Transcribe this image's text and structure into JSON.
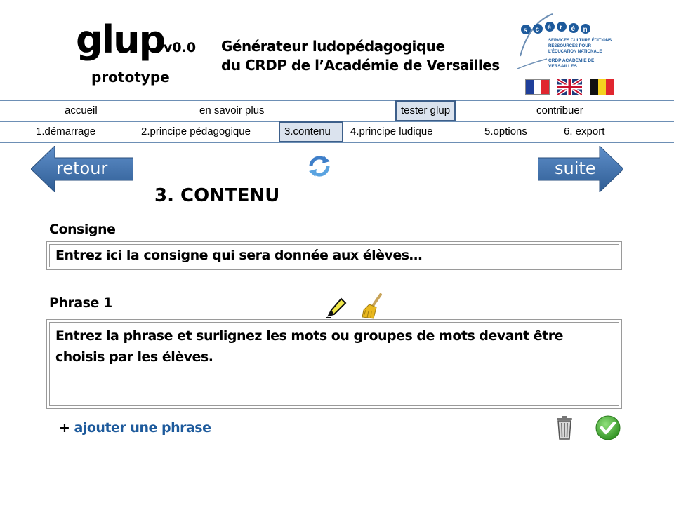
{
  "header": {
    "logo": "glup",
    "version": "v0.0",
    "subtitle": "prototype",
    "tagline_line1": "Générateur ludopédagogique",
    "tagline_line2": "du CRDP de l’Académie de Versailles",
    "partner_logo": {
      "name": "scérén",
      "subtext": "SERVICES CULTURE ÉDITIONS RESSOURCES POUR L’ÉDUCATION NATIONALE",
      "crdp": "CRDP ACADÉMIE DE VERSAILLES"
    },
    "languages": [
      "fr-flag-icon",
      "uk-flag-icon",
      "be-flag-icon"
    ]
  },
  "main_nav": {
    "items": [
      "accueil",
      "en savoir plus",
      "tester glup",
      "contribuer"
    ],
    "active": "tester glup"
  },
  "step_nav": {
    "items": [
      "1.démarrage",
      "2.principe pédagogique",
      "3.contenu",
      "4.principe ludique",
      "5.options",
      "6. export"
    ],
    "active": "3.contenu"
  },
  "controls": {
    "back_label": "retour",
    "next_label": "suite",
    "refresh_icon": "refresh-icon"
  },
  "content": {
    "section_title": "3. CONTENU",
    "instruction_label": "Consigne",
    "instruction_placeholder": "Entrez ici la consigne qui sera donnée aux élèves…",
    "phrase_label": "Phrase 1",
    "phrase_placeholder": "Entrez la phrase et surlignez les mots ou groupes de mots devant être choisis par les élèves.",
    "tools": [
      "highlighter-icon",
      "broom-icon"
    ],
    "add_prefix": "+",
    "add_link": "ajouter une phrase",
    "actions": [
      "trash-icon",
      "check-icon"
    ]
  },
  "colors": {
    "nav_line": "#6d8fb5",
    "arrow_blue": "#3e6ea5",
    "active_border": "#3d5f8a",
    "link": "#1d5a9c",
    "confirm_green": "#3aa02a"
  }
}
